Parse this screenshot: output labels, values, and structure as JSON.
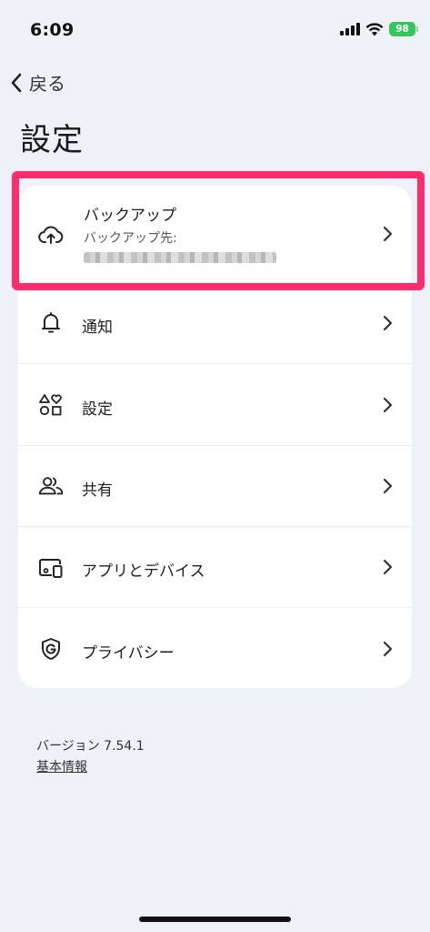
{
  "status_bar": {
    "time": "6:09",
    "battery": "98"
  },
  "header": {
    "back_label": "戻る",
    "title": "設定"
  },
  "backup": {
    "title": "バックアップ",
    "subtitle": "バックアップ先:"
  },
  "menu": [
    {
      "label": "通知",
      "icon": "bell-icon"
    },
    {
      "label": "設定",
      "icon": "shapes-icon"
    },
    {
      "label": "共有",
      "icon": "people-icon"
    },
    {
      "label": "アプリとデバイス",
      "icon": "devices-icon"
    },
    {
      "label": "プライバシー",
      "icon": "google-shield-icon"
    }
  ],
  "footer": {
    "version": "バージョン 7.54.1",
    "about_link": "基本情報"
  },
  "colors": {
    "background": "#eef1f7",
    "card": "#ffffff",
    "highlight": "#ff2d6b",
    "battery": "#34c759"
  }
}
